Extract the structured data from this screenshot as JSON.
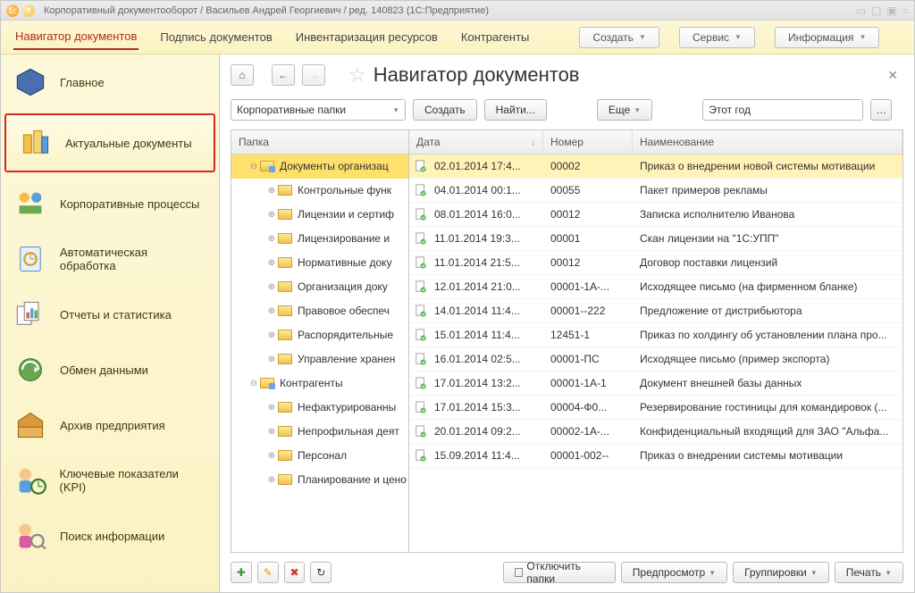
{
  "window_title": "Корпоративный документооборот / Васильев Андрей Георгиевич / ред. 140823  (1С:Предприятие)",
  "menubar": {
    "tabs": [
      "Навигатор документов",
      "Подпись документов",
      "Инвентаризация ресурсов",
      "Контрагенты"
    ],
    "buttons": {
      "create": "Создать",
      "service": "Сервис",
      "info": "Информация"
    }
  },
  "sidebar": [
    {
      "label": "Главное"
    },
    {
      "label": "Актуальные документы"
    },
    {
      "label": "Корпоративные процессы"
    },
    {
      "label": "Автоматическая обработка"
    },
    {
      "label": "Отчеты и статистика"
    },
    {
      "label": "Обмен данными"
    },
    {
      "label": "Архив предприятия"
    },
    {
      "label": "Ключевые показатели (KPI)"
    },
    {
      "label": "Поиск информации"
    }
  ],
  "page": {
    "title": "Навигатор документов",
    "folder_combo": "Корпоративные папки",
    "btn_create": "Создать",
    "btn_find": "Найти...",
    "btn_more": "Еще",
    "filter_year": "Этот год"
  },
  "tree": {
    "header": "Папка",
    "rows": [
      {
        "lvl": 1,
        "exp": "⊖",
        "label": "Документы организац",
        "sel": true,
        "special": true
      },
      {
        "lvl": 2,
        "exp": "⊕",
        "label": "Контрольные функ"
      },
      {
        "lvl": 2,
        "exp": "⊕",
        "label": "Лицензии и сертиф"
      },
      {
        "lvl": 2,
        "exp": "⊕",
        "label": "Лицензирование и"
      },
      {
        "lvl": 2,
        "exp": "⊕",
        "label": "Нормативные доку"
      },
      {
        "lvl": 2,
        "exp": "⊕",
        "label": "Организация доку"
      },
      {
        "lvl": 2,
        "exp": "⊕",
        "label": "Правовое обеспеч"
      },
      {
        "lvl": 2,
        "exp": "⊕",
        "label": "Распорядительные"
      },
      {
        "lvl": 2,
        "exp": "⊕",
        "label": "Управление хранен"
      },
      {
        "lvl": 1,
        "exp": "⊖",
        "label": "Контрагенты",
        "special": true
      },
      {
        "lvl": 2,
        "exp": "⊕",
        "label": "Нефактурированны"
      },
      {
        "lvl": 2,
        "exp": "⊕",
        "label": "Непрофильная деят"
      },
      {
        "lvl": 2,
        "exp": "⊕",
        "label": "Персонал"
      },
      {
        "lvl": 2,
        "exp": "⊕",
        "label": "Планирование и цено"
      }
    ]
  },
  "grid": {
    "headers": {
      "date": "Дата",
      "num": "Номер",
      "name": "Наименование"
    },
    "rows": [
      {
        "date": "02.01.2014 17:4...",
        "num": "00002",
        "name": "Приказ о внедрении новой системы мотивации",
        "sel": true
      },
      {
        "date": "04.01.2014 00:1...",
        "num": "00055",
        "name": "Пакет примеров рекламы"
      },
      {
        "date": "08.01.2014 16:0...",
        "num": "00012",
        "name": "Записка исполнителю Иванова"
      },
      {
        "date": "11.01.2014 19:3...",
        "num": "00001",
        "name": "Скан лицензии на \"1С:УПП\""
      },
      {
        "date": "11.01.2014 21:5...",
        "num": "00012",
        "name": "Договор поставки лицензий"
      },
      {
        "date": "12.01.2014 21:0...",
        "num": "00001-1А-...",
        "name": "Исходящее письмо (на фирменном бланке)"
      },
      {
        "date": "14.01.2014 11:4...",
        "num": "00001--222",
        "name": "Предложение от дистрибьютора"
      },
      {
        "date": "15.01.2014 11:4...",
        "num": "12451-1",
        "name": "Приказ по холдингу об установлении плана про..."
      },
      {
        "date": "16.01.2014 02:5...",
        "num": "00001-ПС",
        "name": "Исходящее письмо (пример экспорта)"
      },
      {
        "date": "17.01.2014 13:2...",
        "num": "00001-1А-1",
        "name": "Документ внешней базы данных"
      },
      {
        "date": "17.01.2014 15:3...",
        "num": "00004-Ф0...",
        "name": "Резервирование гостиницы для командировок (..."
      },
      {
        "date": "20.01.2014 09:2...",
        "num": "00002-1А-...",
        "name": "Конфиденциальный входящий для ЗАО \"Альфа..."
      },
      {
        "date": "15.09.2014 11:4...",
        "num": "00001-002--",
        "name": "Приказ о внедрении системы мотивации"
      }
    ]
  },
  "footer": {
    "toggle_folders": "Отключить папки",
    "preview": "Предпросмотр",
    "group": "Группировки",
    "print": "Печать"
  }
}
